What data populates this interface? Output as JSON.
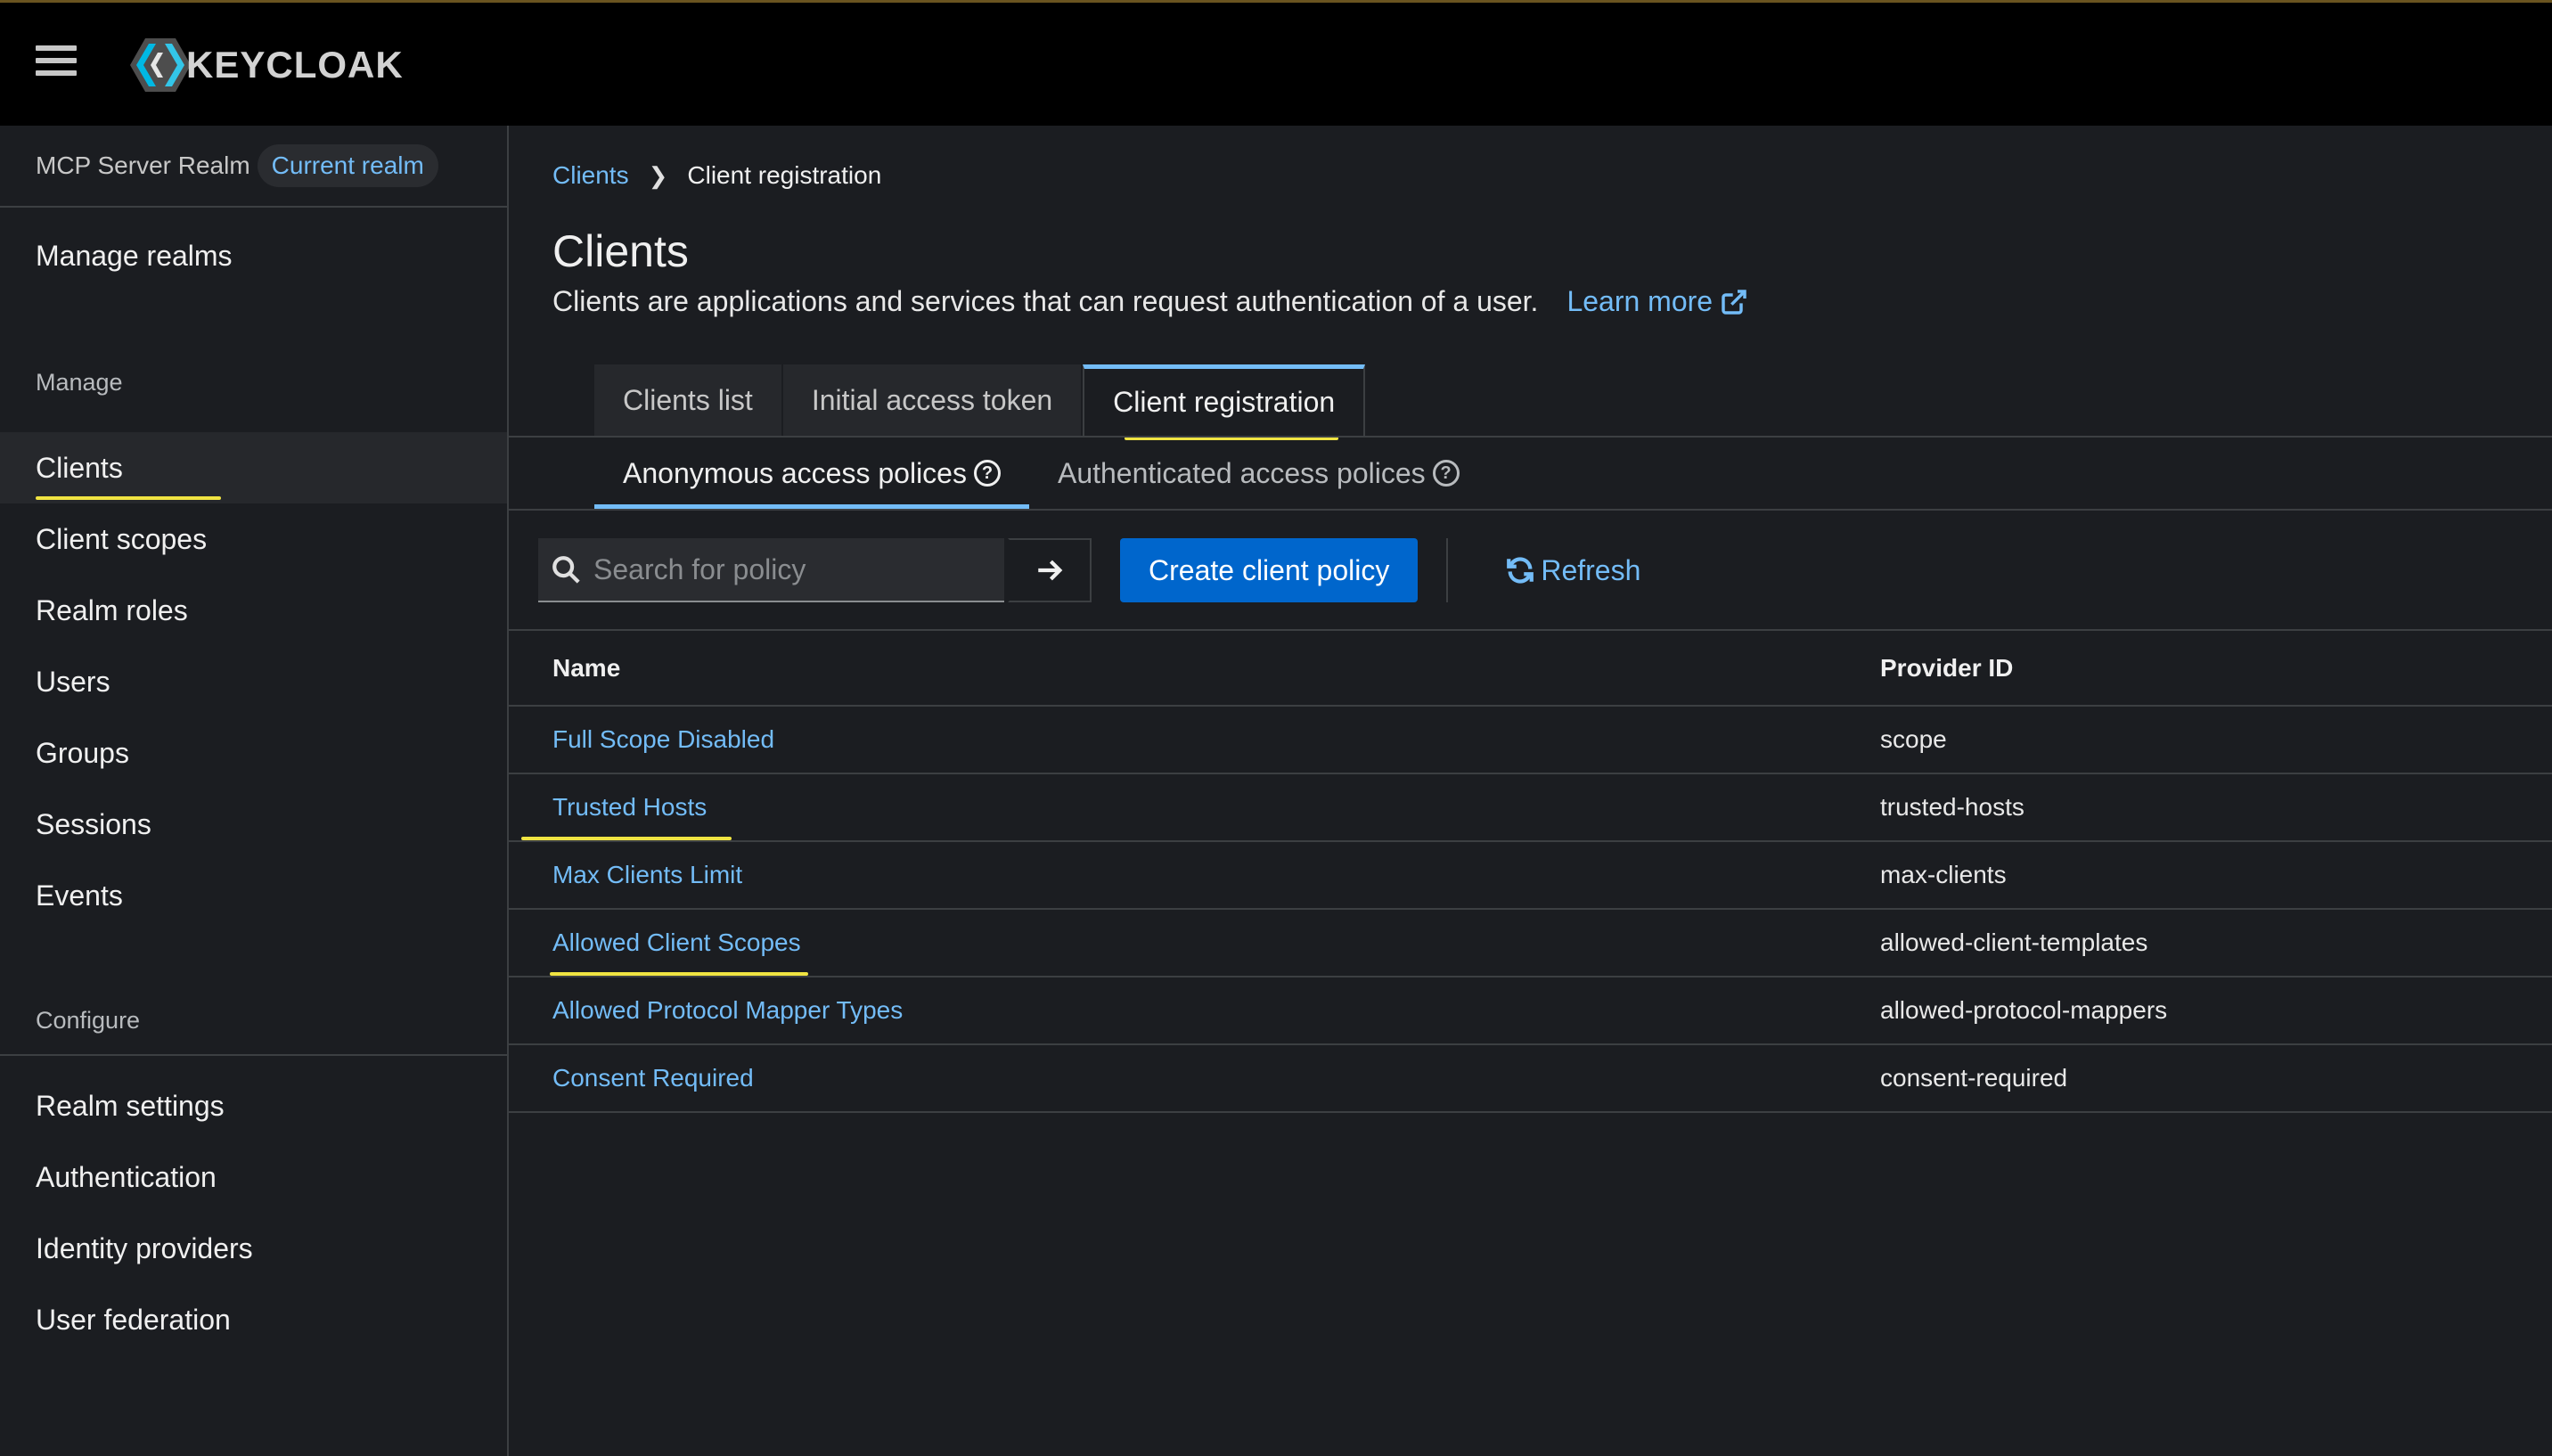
{
  "header": {
    "logo_text": "KEYCLOAK"
  },
  "sidebar": {
    "realm_name": "MCP Server Realm",
    "realm_badge": "Current realm",
    "manage_realms": "Manage realms",
    "manage_title": "Manage",
    "manage_items": [
      "Clients",
      "Client scopes",
      "Realm roles",
      "Users",
      "Groups",
      "Sessions",
      "Events"
    ],
    "configure_title": "Configure",
    "configure_items": [
      "Realm settings",
      "Authentication",
      "Identity providers",
      "User federation"
    ]
  },
  "breadcrumb": {
    "parent": "Clients",
    "current": "Client registration"
  },
  "page": {
    "title": "Clients",
    "description": "Clients are applications and services that can request authentication of a user.",
    "learn_more": "Learn more"
  },
  "tabs": [
    "Clients list",
    "Initial access token",
    "Client registration"
  ],
  "subtabs": [
    "Anonymous access polices",
    "Authenticated access polices"
  ],
  "toolbar": {
    "search_placeholder": "Search for policy",
    "create_label": "Create client policy",
    "refresh_label": "Refresh"
  },
  "table": {
    "headers": [
      "Name",
      "Provider ID"
    ],
    "rows": [
      {
        "name": "Full Scope Disabled",
        "provider": "scope"
      },
      {
        "name": "Trusted Hosts",
        "provider": "trusted-hosts"
      },
      {
        "name": "Max Clients Limit",
        "provider": "max-clients"
      },
      {
        "name": "Allowed Client Scopes",
        "provider": "allowed-client-templates"
      },
      {
        "name": "Allowed Protocol Mapper Types",
        "provider": "allowed-protocol-mappers"
      },
      {
        "name": "Consent Required",
        "provider": "consent-required"
      }
    ]
  },
  "colors": {
    "accent": "#73bcf7",
    "primary_button": "#0066cc",
    "highlight": "#f0e442",
    "background": "#1b1d21"
  }
}
